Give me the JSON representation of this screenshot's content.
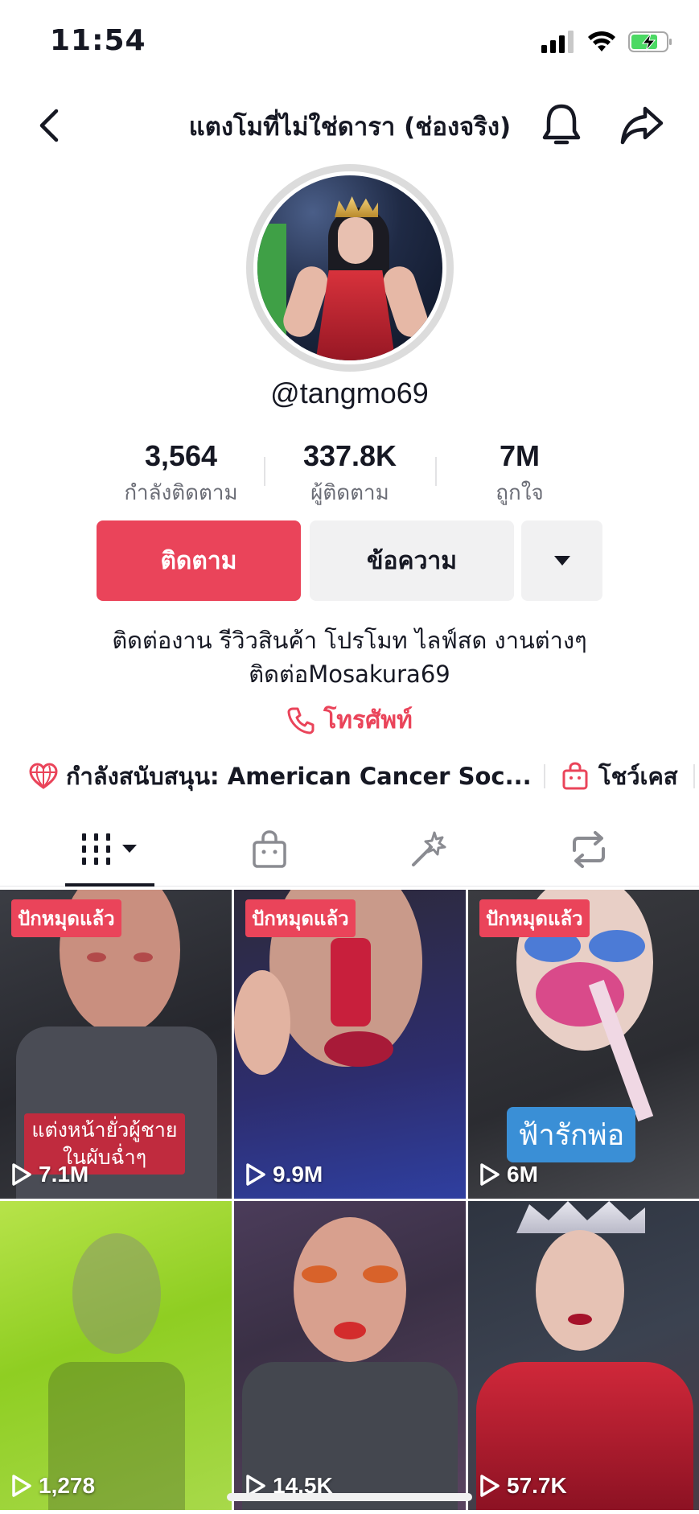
{
  "status": {
    "time": "11:54"
  },
  "header": {
    "title": "แตงโมที่ไม่ใช่ดารา (ช่องจริง)"
  },
  "profile": {
    "username": "@tangmo69",
    "stats": [
      {
        "value": "3,564",
        "label": "กำลังติดตาม"
      },
      {
        "value": "337.8K",
        "label": "ผู้ติดตาม"
      },
      {
        "value": "7M",
        "label": "ถูกใจ"
      }
    ],
    "follow_label": "ติดตาม",
    "message_label": "ข้อความ",
    "bio_line1": "ติดต่องาน รีวิวสินค้า โปรโมท ไลฟ์สด งานต่างๆ",
    "bio_line2": "ติดต่อMosakura69",
    "phone_label": "โทรศัพท์",
    "supporting": "กำลังสนับสนุน: American Cancer Soc...",
    "showcase": "โชว์เคส"
  },
  "colors": {
    "accent": "#ea445a",
    "secondary_button": "#f1f1f2"
  },
  "videos": [
    {
      "pinned": "ปักหมุดแล้ว",
      "views": "7.1M",
      "caption": "แต่งหน้ายั่วผู้ชาย ในผับฉ่ำๆ"
    },
    {
      "pinned": "ปักหมุดแล้ว",
      "views": "9.9M"
    },
    {
      "pinned": "ปักหมุดแล้ว",
      "views": "6M",
      "caption": "ฟ้ารักพ่อ"
    },
    {
      "views": "1,278"
    },
    {
      "views": "14.5K"
    },
    {
      "views": "57.7K"
    }
  ]
}
